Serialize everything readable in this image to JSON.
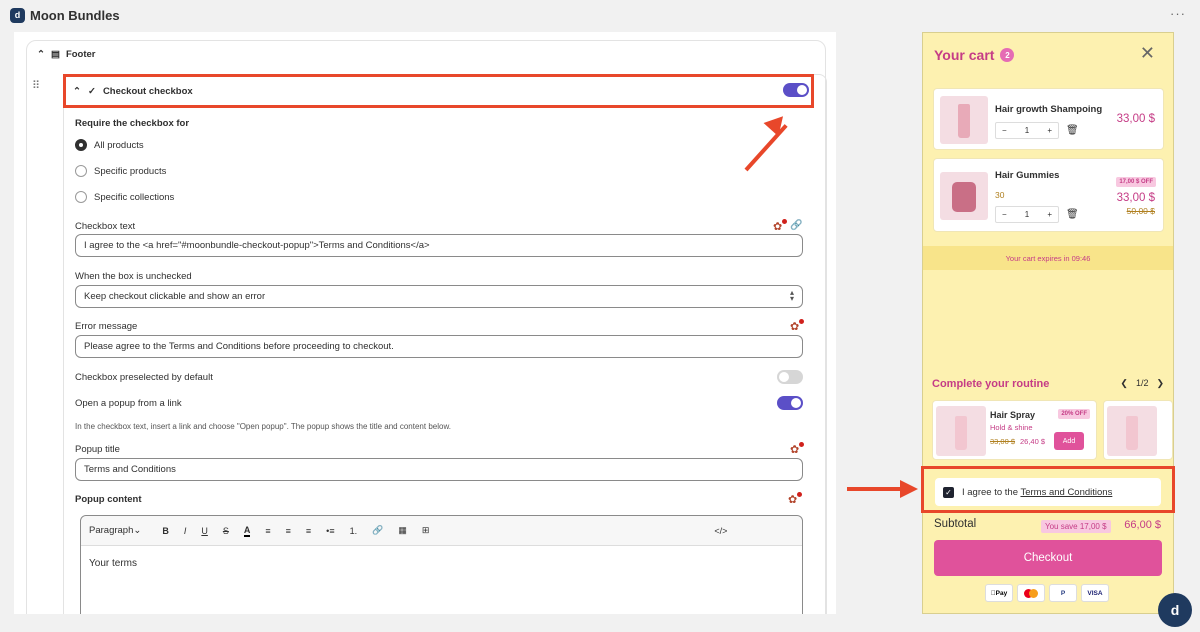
{
  "app": {
    "title": "Moon Bundles",
    "logo": "d",
    "more": "···"
  },
  "footer": {
    "label": "Footer"
  },
  "checkout_checkbox": {
    "label": "Checkout checkbox",
    "enabled": true,
    "require_label": "Require the checkbox for",
    "options": [
      "All products",
      "Specific products",
      "Specific collections"
    ],
    "selected_option": "All products",
    "checkbox_text_label": "Checkbox text",
    "checkbox_text_value": "I agree to the <a href=\"#moonbundle-checkout-popup\">Terms and Conditions</a>",
    "unchecked_label": "When the box is unchecked",
    "unchecked_value": "Keep checkout clickable and show an error",
    "error_label": "Error message",
    "error_value": "Please agree to the Terms and Conditions before proceeding to checkout.",
    "preselected_label": "Checkbox preselected by default",
    "preselected": false,
    "popup_label": "Open a popup from a link",
    "popup_enabled": true,
    "popup_help": "In the checkbox text, insert a link and choose \"Open popup\". The popup shows the title and content below.",
    "popup_title_label": "Popup title",
    "popup_title_value": "Terms and Conditions",
    "popup_content_label": "Popup content",
    "editor": {
      "format": "Paragraph",
      "tools": [
        "B",
        "I",
        "U",
        "S",
        "A",
        "≡",
        "≡",
        "≡",
        "•≡",
        "1.",
        "🔗",
        "▦",
        "⊞",
        "</>"
      ],
      "body": "Your terms"
    }
  },
  "cart": {
    "title": "Your cart",
    "count": "2",
    "items": [
      {
        "name": "Hair growth Shampoing",
        "qty": "1",
        "price": "33,00 $"
      },
      {
        "name": "Hair Gummies",
        "variant": "30",
        "qty": "1",
        "price": "33,00 $",
        "compare": "50,00 $",
        "discount": "17,00 $ OFF"
      }
    ],
    "expiry": "Your cart expires in 09:46",
    "routine_title": "Complete your routine",
    "routine_page": "1/2",
    "upsell": {
      "name": "Hair Spray",
      "subtitle": "Hold & shine",
      "compare": "33,00 $",
      "price": "26,40 $",
      "discount": "20% OFF",
      "add": "Add"
    },
    "agree_prefix": "I agree to the",
    "agree_link": "Terms and Conditions",
    "subtotal_label": "Subtotal",
    "savings": "You save 17,00 $",
    "total": "66,00 $",
    "checkout": "Checkout",
    "payments": [
      "Pay",
      "MC",
      "P",
      "VISA"
    ]
  },
  "colors": {
    "accent": "#5b4fc7",
    "highlight": "#e8472a",
    "brand_pink": "#e0529b",
    "cart_bg": "#fdf1b0"
  }
}
